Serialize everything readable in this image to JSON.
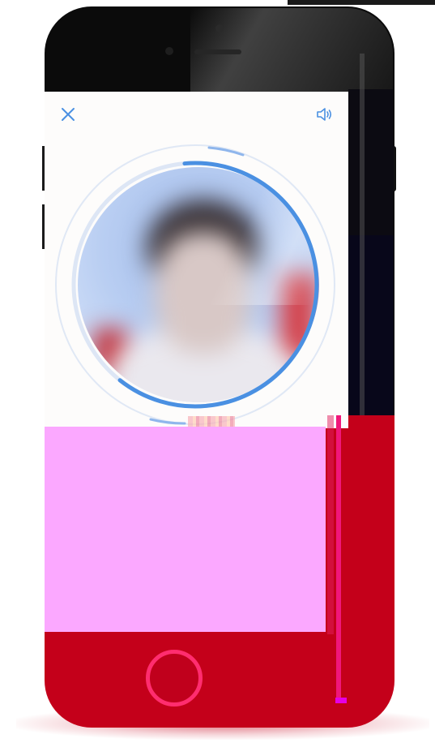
{
  "screen": {
    "close_icon": "close-icon",
    "sound_icon": "speaker-icon",
    "accent_color": "#4a90e2"
  },
  "face_scan": {
    "progress": 0.62,
    "ring_color": "#4a90e2"
  },
  "device": {
    "body_color": "#c4001a",
    "home_button_ring_color": "#ff2d6f"
  }
}
